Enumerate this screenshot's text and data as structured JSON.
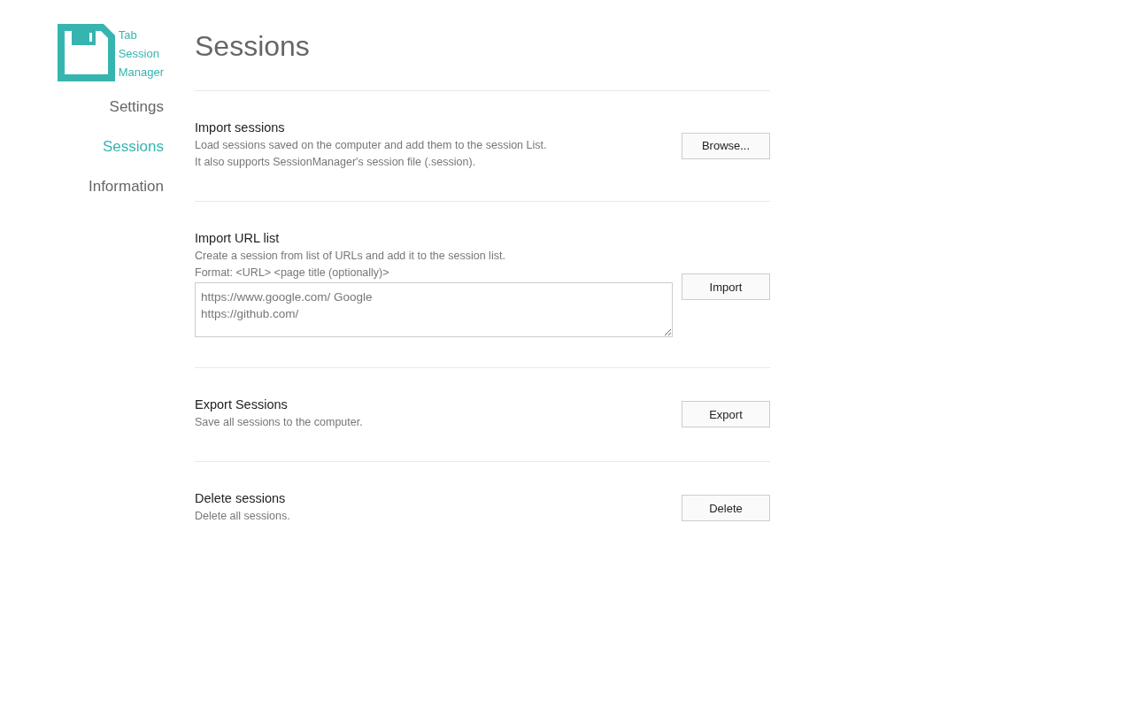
{
  "sidebar": {
    "logo": {
      "lines": [
        "Tab",
        "Session",
        "Manager"
      ]
    },
    "items": [
      {
        "label": "Settings",
        "selected": false
      },
      {
        "label": "Sessions",
        "selected": true
      },
      {
        "label": "Information",
        "selected": false
      }
    ]
  },
  "page_title": "Sessions",
  "sections": [
    {
      "title": "Import sessions",
      "description": [
        "Load sessions saved on the computer and add them to the session List.",
        "It also supports SessionManager's session file (.session)."
      ],
      "button": "Browse..."
    },
    {
      "title": "Import URL list",
      "description": [
        "Create a session from list of URLs and add it to the session list.",
        "Format: <URL> <page title (optionally)>"
      ],
      "textarea": {
        "placeholder": "https://www.google.com/ Google\nhttps://github.com/"
      },
      "button": "Import"
    },
    {
      "title": "Export Sessions",
      "description": [
        "Save all sessions to the computer."
      ],
      "button": "Export"
    },
    {
      "title": "Delete sessions",
      "description": [
        "Delete all sessions."
      ],
      "button": "Delete"
    }
  ]
}
